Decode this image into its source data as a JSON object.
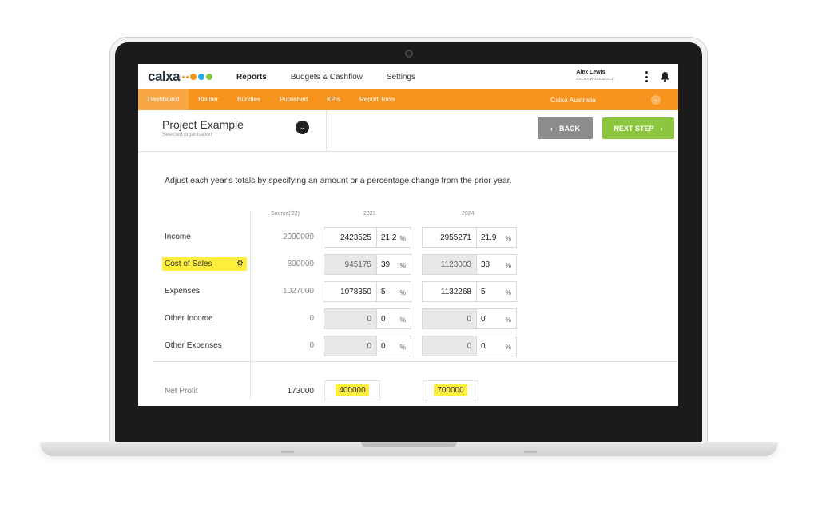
{
  "app": {
    "logo": "calxa",
    "logo_colors": [
      "#f7941d",
      "#29abe2",
      "#8cc63f"
    ]
  },
  "nav": {
    "items": [
      "Reports",
      "Budgets & Cashflow",
      "Settings"
    ]
  },
  "user": {
    "name": "Alex Lewis",
    "workspace": "CALXA WORKSPACE"
  },
  "subnav": {
    "items": [
      "Dashboard",
      "Builder",
      "Bundles",
      "Published",
      "KPIs",
      "Report Tools"
    ],
    "org": "Calxa Australia"
  },
  "project": {
    "title": "Project Example",
    "subtitle": "Selected organisation",
    "back_label": "BACK",
    "next_label": "NEXT STEP"
  },
  "colors": {
    "orange": "#f7941d",
    "green": "#8cc63f",
    "grey_button": "#8c8c8c",
    "highlight": "#ffef3a"
  },
  "main": {
    "instructions": "Adjust each year's totals by specifying an amount or a percentage change from the prior year.",
    "headers": {
      "source": "Source('22)",
      "y1": "2023",
      "y2": "2024"
    },
    "pct_symbol": "%",
    "rows": [
      {
        "label": "Income",
        "source": "2000000",
        "y1_amount": "2423525",
        "y1_pct": "21.2",
        "y2_amount": "2955271",
        "y2_pct": "21.9"
      },
      {
        "label": "Cost of Sales",
        "source": "800000",
        "y1_amount": "945175",
        "y1_pct": "39",
        "y2_amount": "1123003",
        "y2_pct": "38"
      },
      {
        "label": "Expenses",
        "source": "1027000",
        "y1_amount": "1078350",
        "y1_pct": "5",
        "y2_amount": "1132268",
        "y2_pct": "5"
      },
      {
        "label": "Other Income",
        "source": "0",
        "y1_amount": "0",
        "y1_pct": "0",
        "y2_amount": "0",
        "y2_pct": "0"
      },
      {
        "label": "Other Expenses",
        "source": "0",
        "y1_amount": "0",
        "y1_pct": "0",
        "y2_amount": "0",
        "y2_pct": "0"
      }
    ],
    "net": {
      "label": "Net Profit",
      "source": "173000",
      "y1": "400000",
      "y2": "700000"
    }
  }
}
